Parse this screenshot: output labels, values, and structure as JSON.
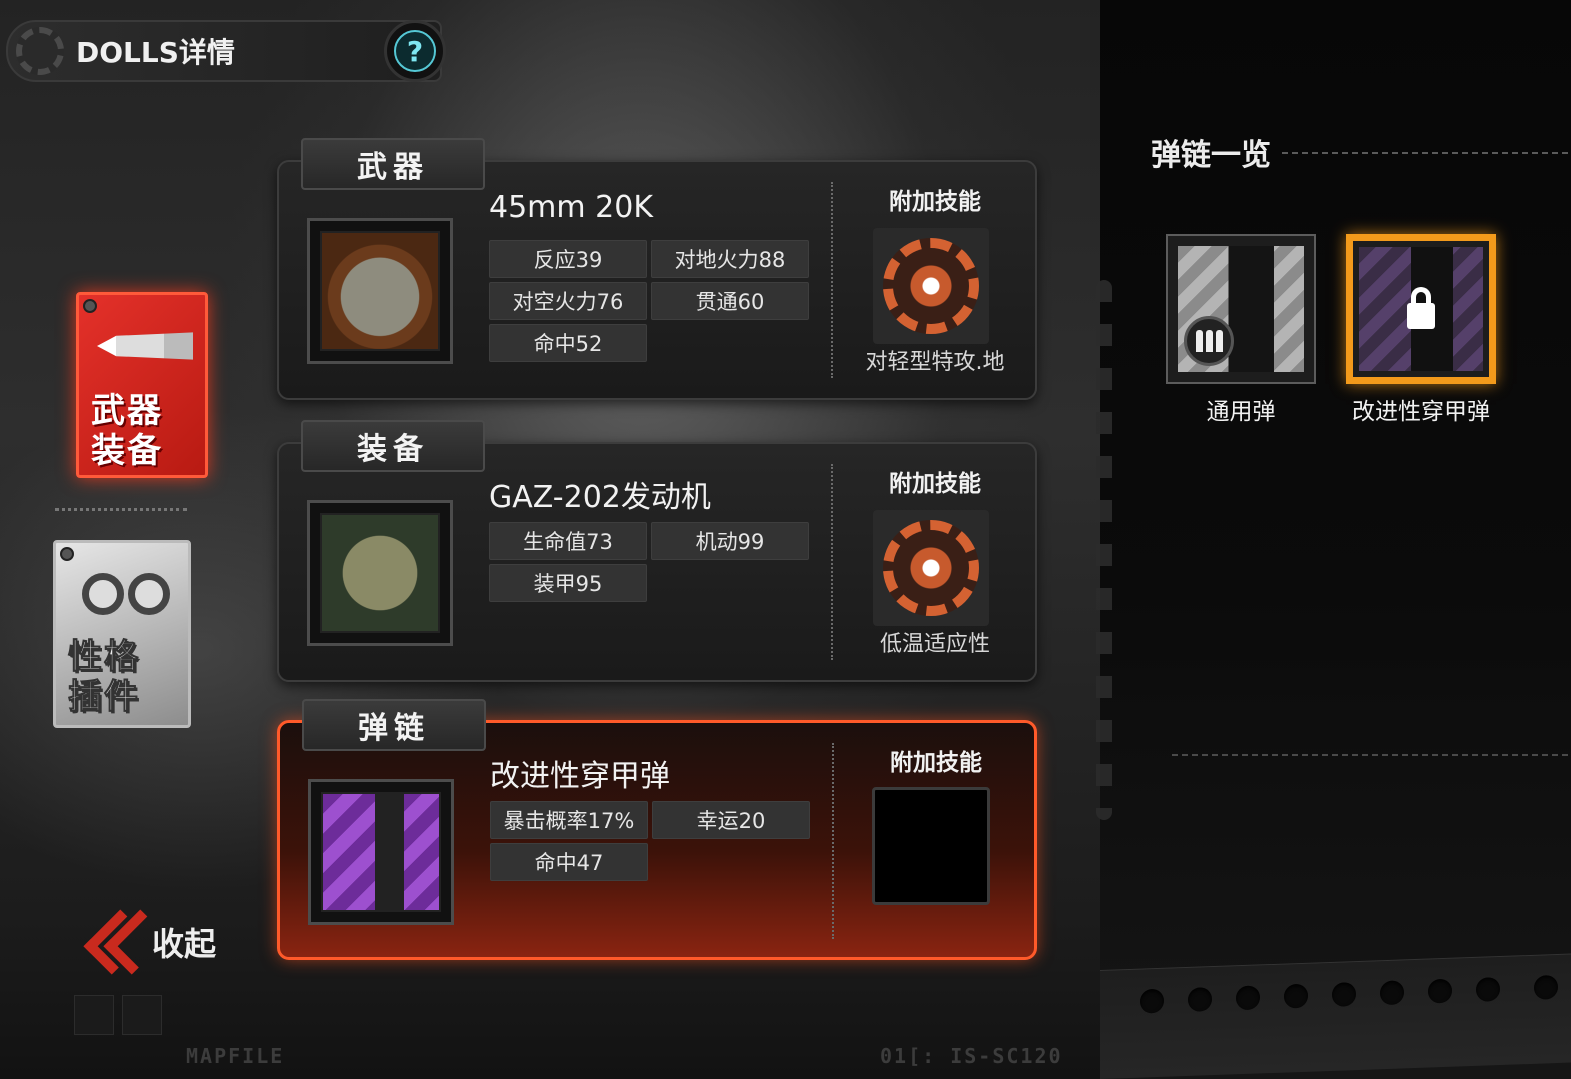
{
  "header": {
    "title": "DOLLS详情",
    "help_label": "?"
  },
  "nav": {
    "weapon_line1": "武器",
    "weapon_line2": "装备",
    "plugin_line1": "性格",
    "plugin_line2": "插件",
    "collapse_label": "收起"
  },
  "footer": {
    "left_text": "MAPFILE",
    "right_text": "01[:  IS-SC120"
  },
  "panels": [
    {
      "tab": "武器",
      "name": "45mm 20K",
      "stats": [
        "反应39",
        "对地火力88",
        "对空火力76",
        "贯通60",
        "命中52"
      ],
      "skill_title": "附加技能",
      "skill_name": "对轻型特攻.地"
    },
    {
      "tab": "装备",
      "name": "GAZ-202发动机",
      "stats": [
        "生命值73",
        "机动99",
        "装甲95"
      ],
      "skill_title": "附加技能",
      "skill_name": "低温适应性"
    },
    {
      "tab": "弹链",
      "name": "改进性穿甲弹",
      "stats": [
        "暴击概率17%",
        "幸运20",
        "命中47"
      ],
      "skill_title": "附加技能",
      "skill_name": ""
    }
  ],
  "belt_list": {
    "title": "弹链一览",
    "items": [
      {
        "label": "通用弹",
        "selected": false,
        "locked": false,
        "icon": "bullets-icon"
      },
      {
        "label": "改进性穿甲弹",
        "selected": true,
        "locked": true,
        "icon": "lock-icon"
      }
    ]
  },
  "colors": {
    "accent_red": "#e4312a",
    "active_orange": "#ff5a2a",
    "select_gold": "#f39a1b"
  }
}
